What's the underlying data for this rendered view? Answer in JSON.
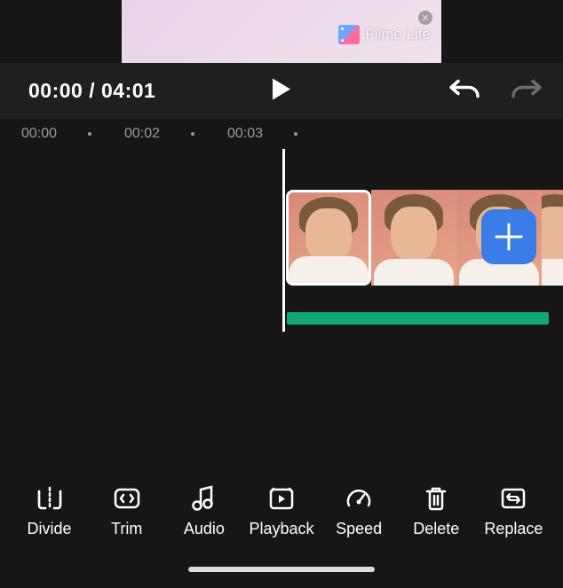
{
  "preview": {
    "watermark_text": "Filme Lite"
  },
  "playback": {
    "current_time": "00:00",
    "total_time": "04:01"
  },
  "ruler": {
    "ticks": [
      "00:00",
      "00:02",
      "00:03"
    ]
  },
  "colors": {
    "accent": "#3a7de8",
    "audio": "#0fa876"
  },
  "toolbar": {
    "items": [
      {
        "label": "Divide",
        "icon": "divide-icon"
      },
      {
        "label": "Trim",
        "icon": "trim-icon"
      },
      {
        "label": "Audio",
        "icon": "audio-icon"
      },
      {
        "label": "Playback",
        "icon": "playback-icon"
      },
      {
        "label": "Speed",
        "icon": "speed-icon"
      },
      {
        "label": "Delete",
        "icon": "delete-icon"
      },
      {
        "label": "Replace",
        "icon": "replace-icon"
      }
    ]
  }
}
